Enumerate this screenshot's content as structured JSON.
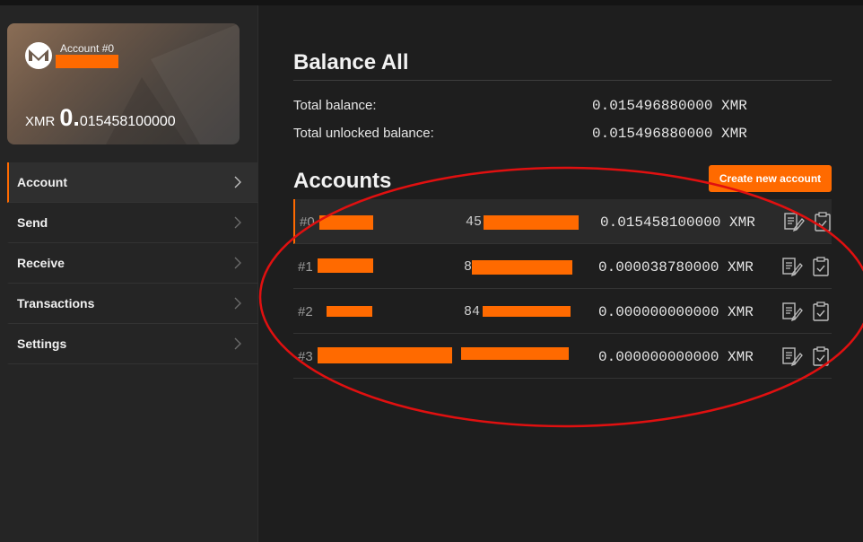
{
  "sidebar": {
    "card": {
      "title": "Account #0",
      "name": "redacted",
      "currency": "XMR",
      "balance_int": "0.",
      "balance_frac": "015458100000"
    },
    "nav": [
      {
        "label": "Account",
        "active": true
      },
      {
        "label": "Send",
        "active": false
      },
      {
        "label": "Receive",
        "active": false
      },
      {
        "label": "Transactions",
        "active": false
      },
      {
        "label": "Settings",
        "active": false
      }
    ]
  },
  "main": {
    "balance_heading": "Balance All",
    "total_balance_label": "Total balance:",
    "total_balance_value": "0.015496880000 XMR",
    "unlocked_balance_label": "Total unlocked balance:",
    "unlocked_balance_value": "0.015496880000 XMR",
    "accounts_heading": "Accounts",
    "create_button": "Create new account",
    "accounts": [
      {
        "index": "#0",
        "addr_prefix": "45",
        "amount": "0.015458100000 XMR"
      },
      {
        "index": "#1",
        "addr_prefix": "8",
        "amount": "0.000038780000 XMR"
      },
      {
        "index": "#2",
        "addr_prefix": "84",
        "amount": "0.000000000000 XMR"
      },
      {
        "index": "#3",
        "addr_prefix": "",
        "amount": "0.000000000000 XMR"
      }
    ]
  },
  "colors": {
    "accent": "#ff6a00",
    "annotation": "#e01010",
    "background": "#1e1e1e"
  },
  "icons": [
    "monero-logo-icon",
    "chevron-right-icon",
    "edit-label-icon",
    "clipboard-copy-icon"
  ]
}
